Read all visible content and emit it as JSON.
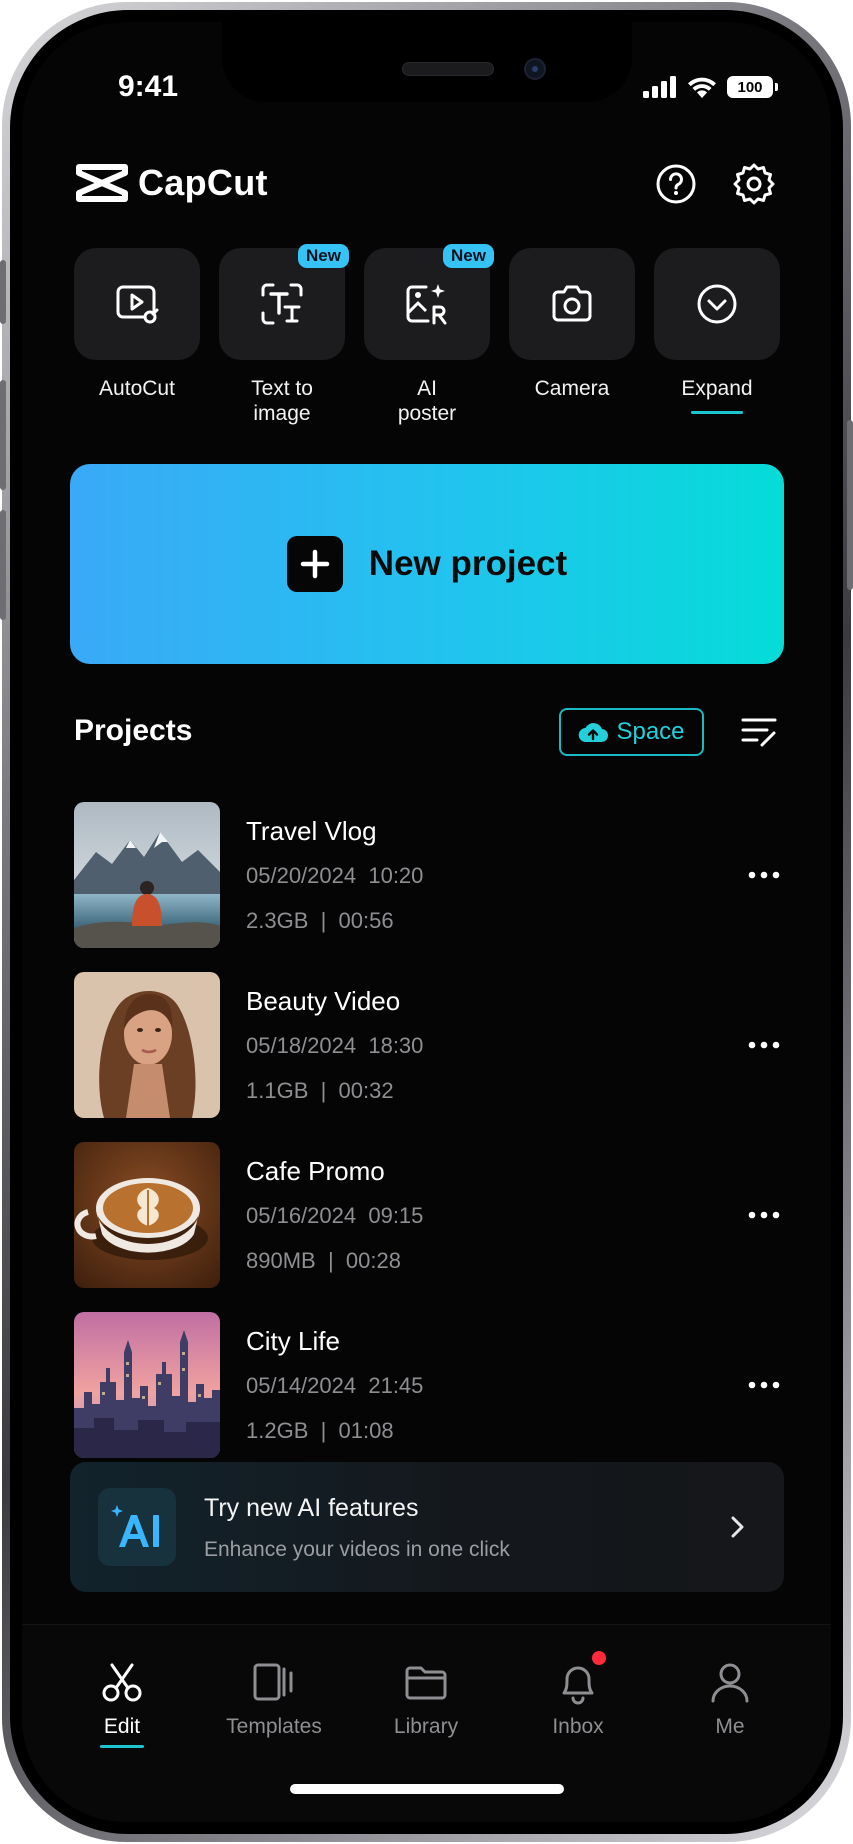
{
  "status_bar": {
    "time": "9:41",
    "battery": "100"
  },
  "header": {
    "brand": "CapCut",
    "help_icon": "help-circle-icon",
    "settings_icon": "gear-icon"
  },
  "tools": [
    {
      "label": "AutoCut",
      "icon": "autocut-icon",
      "badge": ""
    },
    {
      "label": "Text to\nimage",
      "icon": "text-to-image-icon",
      "badge": "New"
    },
    {
      "label": "AI\nposter",
      "icon": "ai-poster-icon",
      "badge": "New"
    },
    {
      "label": "Camera",
      "icon": "camera-icon",
      "badge": ""
    },
    {
      "label": "Expand",
      "icon": "expand-chevron-icon",
      "badge": ""
    }
  ],
  "new_project": {
    "label": "New project"
  },
  "projects": {
    "title": "Projects",
    "space_label": "Space",
    "items": [
      {
        "name": "Travel Vlog",
        "date": "05/20/2024",
        "time": "10:20",
        "size": "2.3GB",
        "duration": "00:56"
      },
      {
        "name": "Beauty Video",
        "date": "05/18/2024",
        "time": "18:30",
        "size": "1.1GB",
        "duration": "00:32"
      },
      {
        "name": "Cafe Promo",
        "date": "05/16/2024",
        "time": "09:15",
        "size": "890MB",
        "duration": "00:28"
      },
      {
        "name": "City Life",
        "date": "05/14/2024",
        "time": "21:45",
        "size": "1.2GB",
        "duration": "01:08"
      }
    ]
  },
  "ai_banner": {
    "title": "Try new AI features",
    "subtitle": "Enhance your videos in one click"
  },
  "tabbar": [
    {
      "label": "Edit",
      "icon": "scissors-icon",
      "active": true
    },
    {
      "label": "Templates",
      "icon": "templates-icon",
      "active": false
    },
    {
      "label": "Library",
      "icon": "folder-icon",
      "active": false
    },
    {
      "label": "Inbox",
      "icon": "bell-icon",
      "active": false
    },
    {
      "label": "Me",
      "icon": "person-icon",
      "active": false
    }
  ],
  "colors": {
    "accent": "#1bc6d0",
    "banner_start": "#3aa9f7",
    "banner_end": "#05dcd8",
    "badge": "#35c3f5",
    "notification": "#ff2a3c"
  }
}
